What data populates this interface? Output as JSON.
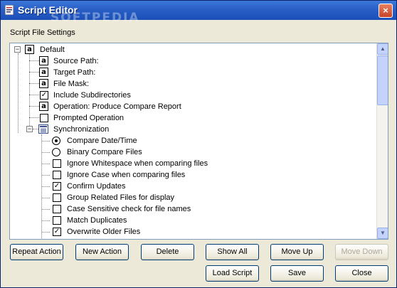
{
  "window": {
    "title": "Script Editor",
    "watermark": "SOFTPEDIA",
    "close_glyph": "×"
  },
  "group_label": "Script File Settings",
  "tree": {
    "root": {
      "label": "Default",
      "expander": "−"
    },
    "items": [
      {
        "label": "Source Path:",
        "kind": "text"
      },
      {
        "label": "Target Path:",
        "kind": "text"
      },
      {
        "label": "File Mask:",
        "kind": "text"
      },
      {
        "label": "Include Subdirectories",
        "kind": "check",
        "checked": true
      },
      {
        "label": "Operation: Produce Compare Report",
        "kind": "text"
      },
      {
        "label": "Prompted Operation",
        "kind": "check",
        "checked": false
      }
    ],
    "sync": {
      "label": "Synchronization",
      "expander": "−",
      "items": [
        {
          "label": "Compare Date/Time",
          "kind": "radio",
          "checked": true
        },
        {
          "label": "Binary Compare Files",
          "kind": "radio",
          "checked": false
        },
        {
          "label": "Ignore Whitespace when comparing files",
          "kind": "check",
          "checked": false
        },
        {
          "label": "Ignore Case when comparing files",
          "kind": "check",
          "checked": false
        },
        {
          "label": "Confirm Updates",
          "kind": "check",
          "checked": true
        },
        {
          "label": "Group Related Files for display",
          "kind": "check",
          "checked": false
        },
        {
          "label": "Case Sensitive check for file names",
          "kind": "check",
          "checked": false
        },
        {
          "label": "Match Duplicates",
          "kind": "check",
          "checked": false
        },
        {
          "label": "Overwrite Older Files",
          "kind": "check",
          "checked": true
        }
      ]
    },
    "icon_text": "a",
    "check_glyph": "✓"
  },
  "scrollbar": {
    "up": "▲",
    "down": "▼"
  },
  "buttons": {
    "repeat_action": "Repeat Action",
    "new_action": "New Action",
    "delete": "Delete",
    "show_all": "Show All",
    "move_up": "Move Up",
    "move_down": "Move Down",
    "load_script": "Load Script",
    "save": "Save",
    "close": "Close"
  },
  "colors": {
    "title_bar": "#2a5fc7",
    "dialog_bg": "#ece9d8",
    "tree_border": "#7f9db9"
  }
}
